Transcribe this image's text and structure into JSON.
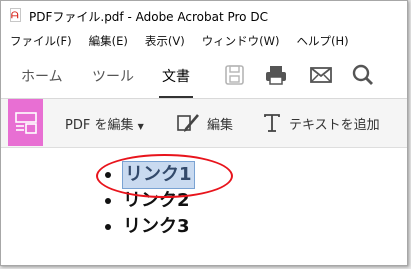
{
  "window": {
    "title": "PDFファイル.pdf - Adobe Acrobat Pro DC"
  },
  "menu": [
    "ファイル(F)",
    "編集(E)",
    "表示(V)",
    "ウィンドウ(W)",
    "ヘルプ(H)"
  ],
  "tabs": [
    {
      "label": "ホーム"
    },
    {
      "label": "ツール"
    },
    {
      "label": "文書"
    }
  ],
  "toolbar": {
    "edit_pdf": "PDF を編集",
    "edit": "編集",
    "add_text": "テキストを追加"
  },
  "document": {
    "links": [
      "リンク1",
      "リンク2",
      "リンク3"
    ]
  },
  "colors": {
    "accent_pink": "#e86fd3",
    "highlight": "#c9daf0",
    "annotation_red": "#e8141c"
  }
}
